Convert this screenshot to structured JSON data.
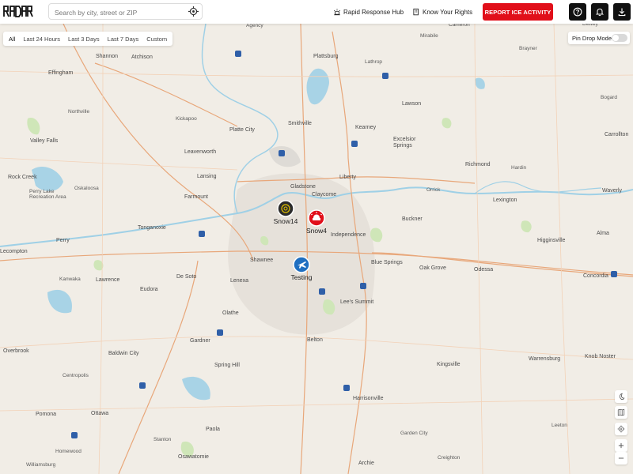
{
  "app": {
    "logo_text": "RADAR"
  },
  "header": {
    "search_placeholder": "Search by city, street or ZIP",
    "nav_rapid_response": "Rapid Response Hub",
    "nav_know_rights": "Know Your Rights",
    "report_button": "REPORT ICE ACTIVITY",
    "icons": [
      "help-icon",
      "bell-icon",
      "download-icon"
    ]
  },
  "filters": {
    "options": [
      "All",
      "Last 24 Hours",
      "Last 3 Days",
      "Last 7 Days",
      "Custom"
    ],
    "selected": "All"
  },
  "pin_drop": {
    "label": "Pin Drop Mode",
    "enabled": false
  },
  "markers": [
    {
      "label": "Snow14",
      "color": "#2b2b2b",
      "icon": "radar-icon"
    },
    {
      "label": "Snow4",
      "color": "#e10f1a",
      "icon": "siren-icon"
    },
    {
      "label": "Testing",
      "color": "#1f6fc1",
      "icon": "airplane-icon"
    }
  ],
  "map_controls": [
    "moon-icon",
    "map-layers-icon",
    "locate-icon",
    "zoom-in-icon",
    "zoom-out-icon"
  ],
  "map_labels": {
    "cities": [
      "Shannon",
      "Atchison",
      "Effingham",
      "Agency",
      "Plattsburg",
      "Lathrop",
      "Brayner",
      "Mirabile",
      "Cameron",
      "Dewey",
      "Bogard",
      "Northville",
      "Smithville",
      "Kearney",
      "Lawson",
      "Kickapoo",
      "Platte City",
      "Valley Falls",
      "Excelsior Springs",
      "Carrollton",
      "Leavenworth",
      "Liberty",
      "Richmond",
      "Hardin",
      "Rock Creek",
      "Perry Lake Recreation Area",
      "Oskaloosa",
      "Lansing",
      "Gladstone",
      "Claycome",
      "Orrick",
      "Lexington",
      "Waverly",
      "Farmount",
      "Buckner",
      "Tonganoxie",
      "Independence",
      "Higginsville",
      "Alma",
      "Perry",
      "Lecompton",
      "Shawnee",
      "Lenexa",
      "Blue Springs",
      "Oak Grove",
      "Odessa",
      "Concordia",
      "Kanwaka",
      "Lawrence",
      "De Soto",
      "Eudora",
      "Olathe",
      "Lee's Summit",
      "Overbrook",
      "Baldwin City",
      "Gardner",
      "Spring Hill",
      "Belton",
      "Kingsville",
      "Warrensburg",
      "Knob Noster",
      "Centropolis",
      "Harrisonville",
      "Pomona",
      "Ottawa",
      "Paola",
      "Garden City",
      "Leeton",
      "Stanton",
      "Homewood",
      "Osawatomie",
      "Archie",
      "Creighton",
      "Williamsburg"
    ]
  }
}
